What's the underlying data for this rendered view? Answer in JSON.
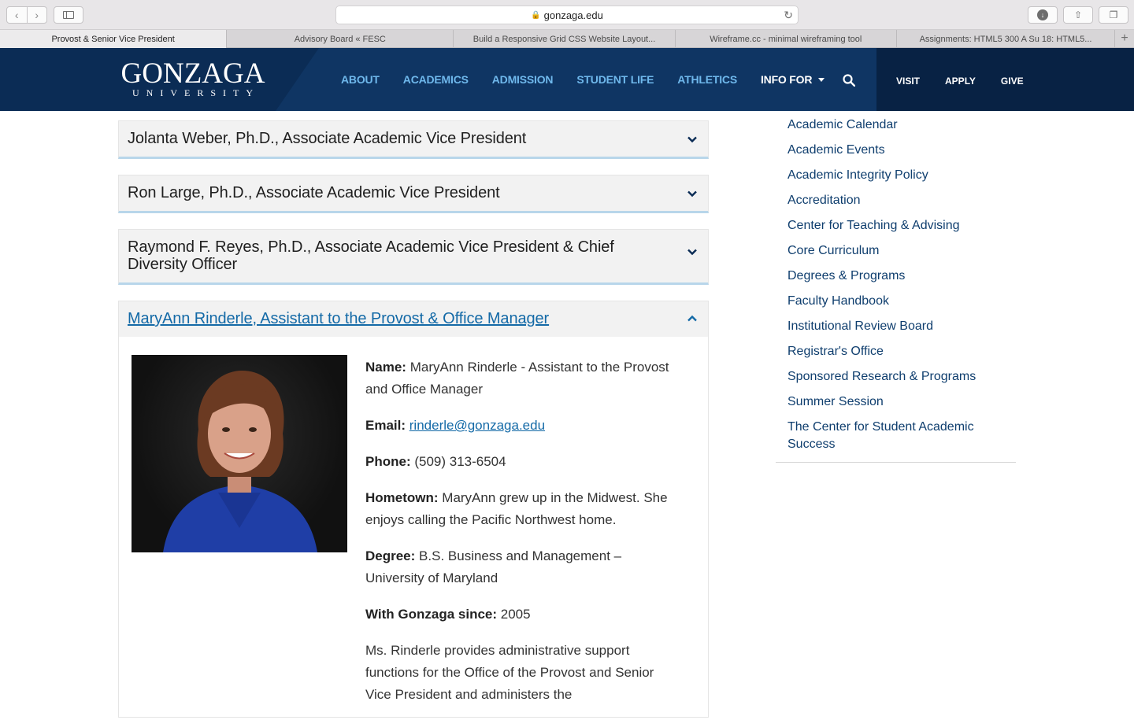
{
  "browser": {
    "url": "gonzaga.edu",
    "tabs": [
      "Provost & Senior Vice President",
      "Advisory Board « FESC",
      "Build a Responsive Grid CSS Website Layout...",
      "Wireframe.cc - minimal wireframing tool",
      "Assignments: HTML5 300 A Su 18: HTML5..."
    ]
  },
  "header": {
    "logo_top": "GONZAGA",
    "logo_bottom": "UNIVERSITY",
    "nav": [
      "ABOUT",
      "ACADEMICS",
      "ADMISSION",
      "STUDENT LIFE",
      "ATHLETICS",
      "INFO FOR"
    ],
    "utility": [
      "VISIT",
      "APPLY",
      "GIVE"
    ]
  },
  "accordions": [
    "Jolanta Weber, Ph.D., Associate Academic Vice President",
    "Ron Large, Ph.D., Associate Academic Vice President",
    "Raymond F. Reyes, Ph.D., Associate Academic Vice President & Chief Diversity Officer",
    "MaryAnn Rinderle, Assistant to the Provost & Office Manager"
  ],
  "profile": {
    "name_label": "Name:",
    "name_value": "MaryAnn Rinderle - Assistant to the Provost and Office Manager",
    "email_label": "Email:",
    "email_value": "rinderle@gonzaga.edu",
    "phone_label": "Phone:",
    "phone_value": "(509) 313-6504",
    "hometown_label": "Hometown:",
    "hometown_value": "MaryAnn grew up in the Midwest. She enjoys calling the Pacific Northwest home.",
    "degree_label": "Degree:",
    "degree_value": "B.S. Business and Management – University of Maryland",
    "since_label": "With Gonzaga since:",
    "since_value": "2005",
    "bio": "Ms. Rinderle provides administrative support functions for the Office of the Provost and Senior Vice President and administers the"
  },
  "sidebar": {
    "links": [
      "Academic Calendar",
      "Academic Events",
      "Academic Integrity Policy",
      "Accreditation",
      "Center for Teaching & Advising",
      "Core Curriculum",
      "Degrees & Programs",
      "Faculty Handbook",
      "Institutional Review Board",
      "Registrar's Office",
      "Sponsored Research & Programs",
      "Summer Session",
      "The Center for Student Academic Success"
    ]
  },
  "colors": {
    "header_bg": "#0b2c55",
    "nav_link": "#6fb8ec",
    "link": "#146aa7",
    "accordion_border": "#b8d6ea"
  }
}
